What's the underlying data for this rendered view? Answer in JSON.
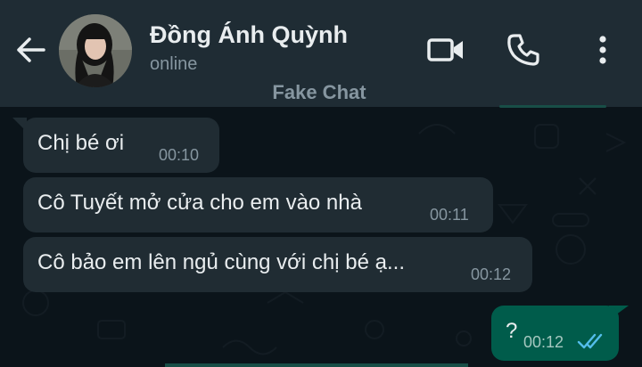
{
  "header": {
    "contact_name": "Đồng Ánh Quỳnh",
    "status": "online",
    "icons": {
      "back": "arrow-left-icon",
      "video": "video-camera-icon",
      "call": "phone-icon",
      "menu": "more-vertical-icon"
    }
  },
  "chat": {
    "label": "Fake Chat",
    "messages": [
      {
        "direction": "incoming",
        "text": "Chị bé ơi",
        "time": "00:10"
      },
      {
        "direction": "incoming",
        "text": "Cô Tuyết mở cửa cho em vào nhà",
        "time": "00:11"
      },
      {
        "direction": "incoming",
        "text": "Cô bảo em lên ngủ cùng với chị bé ạ...",
        "time": "00:12"
      },
      {
        "direction": "outgoing",
        "text": "?",
        "time": "00:12",
        "status": "read"
      }
    ]
  },
  "colors": {
    "header_bg": "#1f2c34",
    "chat_bg": "#0b141a",
    "incoming_bubble": "#202c33",
    "outgoing_bubble": "#005c4b",
    "read_ticks": "#53bdeb",
    "text_primary": "#e9edef",
    "text_secondary": "#8696a0"
  }
}
